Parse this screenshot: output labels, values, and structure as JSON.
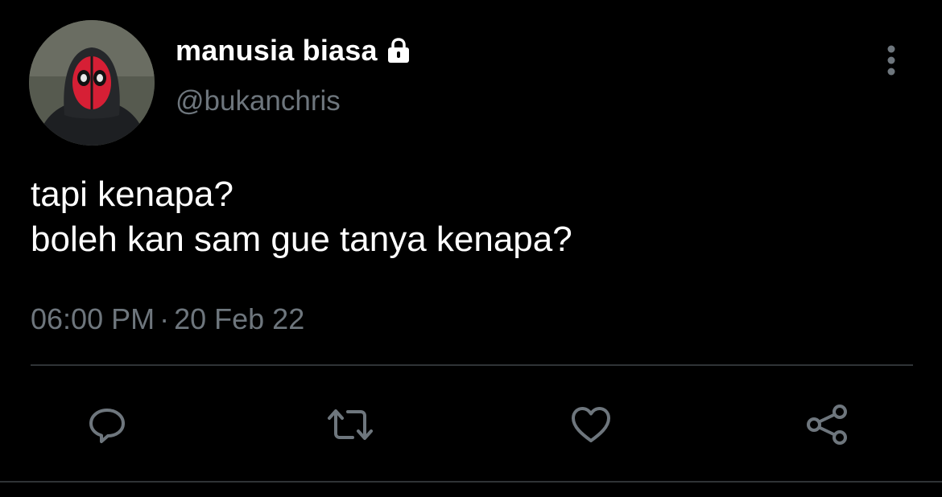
{
  "tweet": {
    "display_name": "manusia biasa",
    "handle": "@bukanchris",
    "text_lines": [
      "tapi kenapa?",
      "boleh kan sam gue tanya kenapa?"
    ],
    "time": "06:00 PM",
    "separator": "·",
    "date": "20 Feb 22"
  },
  "icons": {
    "lock": "lock-icon",
    "more": "more-vertical-icon",
    "reply": "reply-icon",
    "retweet": "retweet-icon",
    "like": "heart-icon",
    "share": "share-icon"
  },
  "colors": {
    "background": "#000000",
    "text_primary": "#ffffff",
    "text_secondary": "#6e767d",
    "divider": "#2f3336",
    "icon": "#6e767d",
    "mask_red": "#d61f35"
  }
}
